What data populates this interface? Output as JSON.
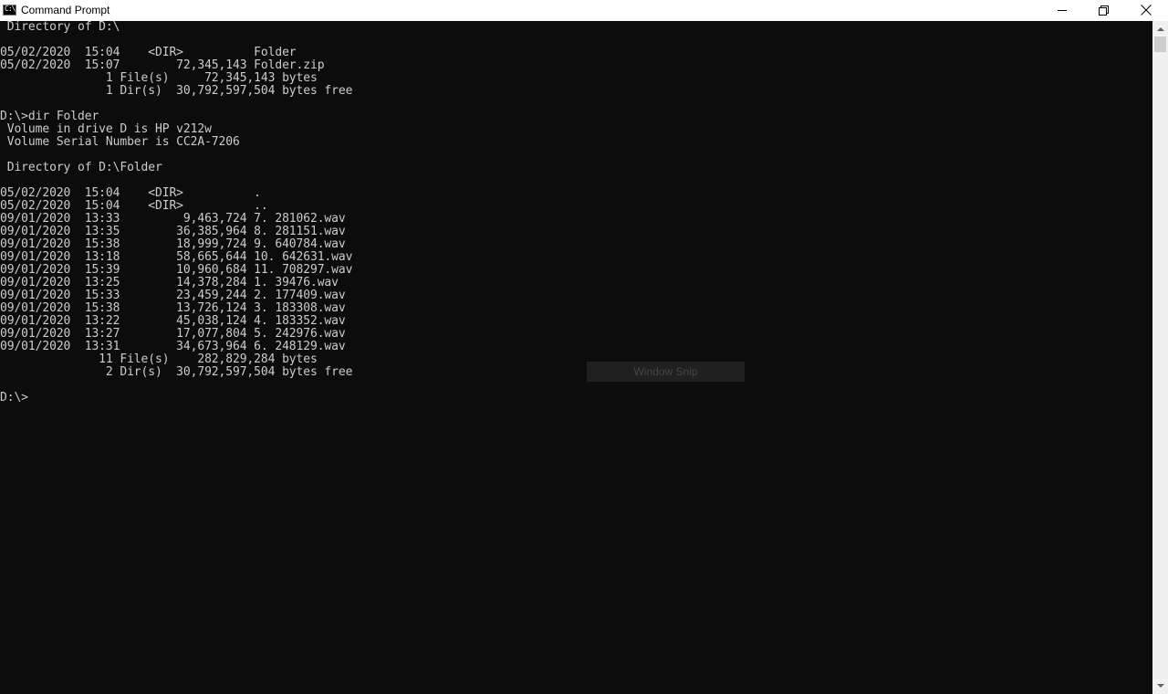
{
  "window": {
    "title": "Command Prompt",
    "icon": "cmd-icon",
    "icon_glyph": "C:\\"
  },
  "controls": {
    "minimize": "minimize-icon",
    "restore": "restore-icon",
    "close": "close-icon"
  },
  "console": {
    "lines": [
      " Directory of D:\\",
      "",
      "05/02/2020  15:04    <DIR>          Folder",
      "05/02/2020  15:07        72,345,143 Folder.zip",
      "               1 File(s)     72,345,143 bytes",
      "               1 Dir(s)  30,792,597,504 bytes free",
      "",
      "D:\\>dir Folder",
      " Volume in drive D is HP v212w",
      " Volume Serial Number is CC2A-7206",
      "",
      " Directory of D:\\Folder",
      "",
      "05/02/2020  15:04    <DIR>          .",
      "05/02/2020  15:04    <DIR>          ..",
      "09/01/2020  13:33         9,463,724 7. 281062.wav",
      "09/01/2020  13:35        36,385,964 8. 281151.wav",
      "09/01/2020  15:38        18,999,724 9. 640784.wav",
      "09/01/2020  13:18        58,665,644 10. 642631.wav",
      "09/01/2020  15:39        10,960,684 11. 708297.wav",
      "09/01/2020  13:25        14,378,284 1. 39476.wav",
      "09/01/2020  15:33        23,459,244 2. 177409.wav",
      "09/01/2020  15:38        13,726,124 3. 183308.wav",
      "09/01/2020  13:22        45,038,124 4. 183352.wav",
      "09/01/2020  13:27        17,077,804 5. 242976.wav",
      "09/01/2020  13:31        34,673,964 6. 248129.wav",
      "              11 File(s)    282,829,284 bytes",
      "               2 Dir(s)  30,792,597,504 bytes free",
      "",
      "D:\\>"
    ],
    "text_color": "#cccccc",
    "background": "#0c0c0c"
  },
  "overlay": {
    "label": "Window Snip"
  }
}
